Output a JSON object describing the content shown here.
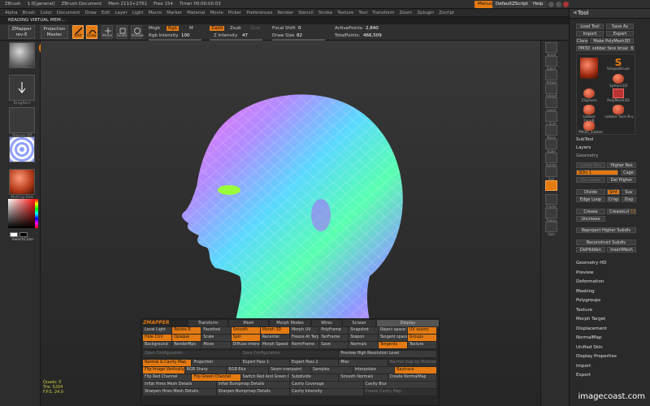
{
  "titlebar": {
    "items": [
      "ZBrush",
      "1.0[general]",
      "ZBrush Document",
      "Mem 2113+2761",
      "Free 154",
      "Timer 00:00:00.03"
    ],
    "menus_button": "Menus",
    "script_button": "DefaultZScript",
    "help_button": "Help"
  },
  "menus": [
    "Alpha",
    "Brush",
    "Color",
    "Document",
    "Draw",
    "Edit",
    "Layer",
    "Light",
    "Macro",
    "Marker",
    "Material",
    "Movie",
    "Picker",
    "Preferences",
    "Render",
    "Stencil",
    "Stroke",
    "Texture",
    "Tool",
    "Transform",
    "Zoom",
    "Zplugin",
    "Zscript"
  ],
  "notice": "READING VIRTUAL MEM...",
  "toolbar": {
    "zmapper_label": "ZMapper",
    "zmapper_sub": "rev-E",
    "projection_label": "Projection",
    "projection_sub": "Master",
    "edit": "Edit",
    "draw": "Draw",
    "move": "Move",
    "scale": "Scale",
    "rotate": "Rotate",
    "mrgb": "Mrgb",
    "rgb": "Rgb",
    "m": "M",
    "zadd": "Zadd",
    "zsub": "Zsub",
    "zcut": "Zcut",
    "rgb_intensity_label": "Rgb Intensity",
    "rgb_intensity_value": "100",
    "rgb_intensity": 1.0,
    "z_intensity_label": "Z Intensity",
    "z_intensity_value": "47",
    "z_intensity": 0.47,
    "focal_label": "Focal Shift",
    "focal_value": "0",
    "draw_size_label": "Draw Size",
    "draw_size_value": "82",
    "draw_size": 0.32,
    "active_points_label": "ActivePoints:",
    "active_points": "2,840",
    "total_points_label": "TotalPoints:",
    "total_points": "466,509"
  },
  "leftshelf": {
    "labels": [
      "",
      "",
      "DragRect",
      "Texture Off",
      "",
      "MatCap Red"
    ],
    "switch_color": "SwitchColor"
  },
  "rightshelf": {
    "buttons": [
      "Scroll",
      "Zoom",
      "Actual",
      "AAHalf",
      "Local",
      "L.Sym",
      "Move",
      "Scale",
      "Rotate",
      "Xyz",
      "",
      "Frame",
      "Transp",
      "Solo"
    ]
  },
  "tool": {
    "title": "Tool",
    "load_tool": "Load Tool",
    "save_as": "Save As",
    "import": "Import",
    "export": "Export",
    "clone": "Clone",
    "make_polymesh": "Make PolyMesh3D",
    "current_tool": "PM3D_sobber face broad",
    "current_count": "6",
    "thumbs": [
      "",
      "SimpleBrush",
      "Sphere3D",
      "ZSphere",
      "PolyMesh3D",
      "sobber FaceB",
      "sobber face B-y",
      "PM3D_sobber"
    ],
    "subtool": "SubTool",
    "layers": "Layers",
    "geometry": "Geometry",
    "lower_res": "Lower Res",
    "higher_res": "Higher Res",
    "sdiv": "SDiv",
    "sdiv_value": "1",
    "cage": "Cage",
    "del_lower": "Del Lower",
    "del_higher": "Del Higher",
    "divide": "Divide",
    "smt": "Smt",
    "suv": "Suv",
    "edge_loop": "Edge Loop",
    "crisp": "Crisp",
    "disp": "Disp",
    "crease": "Crease",
    "crease_lvl_label": "CreaseLvl",
    "crease_lvl_value": "15",
    "uncrease": "Uncrease",
    "reproject": "Reproject Higher Subdiv",
    "reconstruct": "Reconstruct Subdiv",
    "del_hidden": "DelHidden",
    "insert_mesh": "InsertMesh",
    "sections": [
      "Geometry HD",
      "Preview",
      "Deformation",
      "Masking",
      "Polygroups",
      "Texture",
      "Morph Target",
      "Displacement",
      "NormalMap",
      "Unified Skin",
      "Display Properties",
      "Import",
      "Export"
    ]
  },
  "zmapper": {
    "logo": "ZMAPPER",
    "tabs": [
      "Transform",
      "Mesh",
      "Morph Modes",
      "Wires",
      "Screen",
      "Display"
    ],
    "rows": [
      [
        {
          "t": "Local Light",
          "s": "g"
        },
        {
          "t": "Rotate R",
          "s": "o"
        },
        {
          "t": "Facetted",
          "s": "g"
        },
        {
          "t": "Smooth",
          "s": "o"
        },
        {
          "t": "Morph 3D",
          "s": "o"
        },
        {
          "t": "Morph UV",
          "s": "g"
        },
        {
          "t": "PolyFrame",
          "s": "g"
        },
        {
          "t": "Snapshot",
          "s": "g"
        },
        {
          "t": "Object space N.Map",
          "s": "g"
        },
        {
          "t": "UV seams",
          "s": "o"
        }
      ],
      [
        {
          "t": "Hide CUV",
          "s": "o"
        },
        {
          "t": "Opaque",
          "s": "o"
        },
        {
          "t": "Scale",
          "s": "g"
        },
        {
          "t": "Spin",
          "s": "o"
        },
        {
          "t": "Recenter",
          "s": "g"
        },
        {
          "t": "Freeze At Target",
          "s": "g"
        },
        {
          "t": "TanFrame",
          "s": "g"
        },
        {
          "t": "Stepon",
          "s": "g"
        },
        {
          "t": "Tangent space N.Map",
          "s": "g"
        },
        {
          "t": "Groups",
          "s": "o"
        }
      ],
      [
        {
          "t": "Background",
          "s": "g"
        },
        {
          "t": "RenderMps",
          "s": "g"
        },
        {
          "t": "Move",
          "s": "g"
        },
        {
          "t": "Diffuse intensity",
          "s": "g"
        },
        {
          "t": "Morph Speed",
          "s": "g"
        },
        {
          "t": "NormFrame",
          "s": "g"
        },
        {
          "t": "Save",
          "s": "g"
        },
        {
          "t": "Normals",
          "s": "g"
        },
        {
          "t": "Tangents",
          "s": "o"
        },
        {
          "t": "Texture",
          "s": "g"
        }
      ],
      [
        {
          "t": "Open Configuration",
          "s": "d"
        },
        {
          "t": "Save Configuration",
          "s": "d"
        },
        {
          "t": "Preview High Resolution Level",
          "s": "g"
        }
      ],
      [
        {
          "t": "Normal & Cavity Map",
          "s": "o"
        },
        {
          "t": "Projection",
          "s": "g"
        },
        {
          "t": "Expert Pass 1",
          "s": "g"
        },
        {
          "t": "Expert Pass 2",
          "s": "g"
        },
        {
          "t": "Misc",
          "s": "g"
        },
        {
          "t": "Normal map by Photoshop",
          "s": "d"
        }
      ],
      [
        {
          "t": "Flip Image Vertically",
          "s": "o"
        },
        {
          "t": "RGB Sharp",
          "s": "g"
        },
        {
          "t": "RGB Blur",
          "s": "g"
        },
        {
          "t": "Seam overpaint",
          "s": "g"
        },
        {
          "t": "Samples",
          "s": "g"
        },
        {
          "t": "Interpolate",
          "s": "g"
        },
        {
          "t": "Raytrace",
          "s": "o"
        }
      ],
      [
        {
          "t": "Flip Red Channel",
          "s": "g"
        },
        {
          "t": "Flip Green Channel",
          "s": "o"
        },
        {
          "t": "Switch Red And Green Channels",
          "s": "g"
        },
        {
          "t": "Subdivide",
          "s": "g"
        },
        {
          "t": "Smooth Normals",
          "s": "g"
        },
        {
          "t": "Create NormalMap",
          "s": "g"
        }
      ],
      [
        {
          "t": "Inflat Hires Mesh Details",
          "s": "g"
        },
        {
          "t": "Inflat Bumpmap Details",
          "s": "g"
        },
        {
          "t": "Cavity Coverage",
          "s": "g"
        },
        {
          "t": "Cavity Blur",
          "s": "g"
        }
      ],
      [
        {
          "t": "Sharpen Hires Mesh Details",
          "s": "g"
        },
        {
          "t": "Sharpen Bumpmap Details",
          "s": "g"
        },
        {
          "t": "Cavity Intensity",
          "s": "g"
        },
        {
          "t": "Create Cavity Map",
          "s": "d"
        }
      ]
    ]
  },
  "hud": {
    "quads": "Quads: 0",
    "tris": "Tris: 5204",
    "fps": "F.P.S. 24.0"
  },
  "watermark": "imagecoast.com",
  "colors": {
    "accent": "#e47a12",
    "panel": "#2a2a2a",
    "button": "#3b3b3b"
  }
}
